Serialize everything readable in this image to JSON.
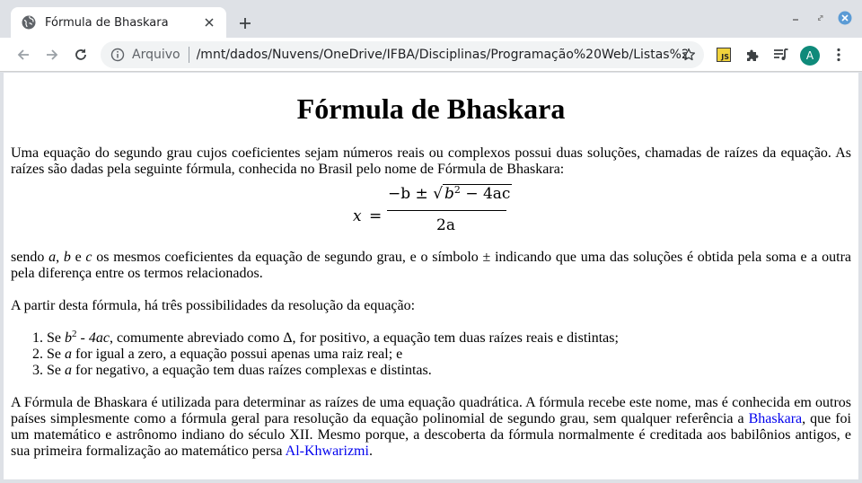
{
  "browser": {
    "tab_title": "Fórmula de Bhaskara",
    "omnibox_label": "Arquivo",
    "url": "/mnt/dados/Nuvens/OneDrive/IFBA/Disciplinas/Programação%20Web/Listas%20...",
    "avatar_initial": "A",
    "js_extension_label": "JS"
  },
  "page": {
    "title": "Fórmula de Bhaskara",
    "intro": "Uma equação do segundo grau cujos coeficientes sejam números reais ou complexos possui duas soluções, chamadas de raízes da equação. As raízes são dadas pela seguinte fórmula, conhecida no Brasil pelo nome de Fórmula de Bhaskara:",
    "formula": {
      "lhs": "x",
      "equals": "=",
      "numerator_prefix": "−b ± ",
      "radicand_b": "b",
      "radicand_exp": "2",
      "radicand_rest": " − 4ac",
      "denominator": "2a"
    },
    "p2": {
      "t1": "sendo ",
      "a": "a",
      "comma": ", ",
      "b": "b",
      "and": " e ",
      "c": "c",
      "t2": " os mesmos coeficientes da equação de segundo grau, e o símbolo ± indicando que uma das soluções é obtida pela soma e a outra pela diferença entre os termos relacionados."
    },
    "p3": "A partir desta fórmula, há três possibilidades da resolução da equação:",
    "list": {
      "item1": {
        "se": "Se ",
        "b": "b",
        "exp": "2",
        "rest_expr": " - 4ac",
        "text": ", comumente abreviado como Δ, for positivo, a equação tem duas raízes reais e distintas;"
      },
      "item2": {
        "se": "Se ",
        "a": "a",
        "text": " for igual a zero, a equação possui apenas uma raiz real; e"
      },
      "item3": {
        "se": "Se ",
        "a": "a",
        "text": " for negativo, a equação tem duas raízes complexas e distintas."
      }
    },
    "p4": {
      "t1": "A Fórmula de Bhaskara é utilizada para determinar as raízes de uma equação quadrática. A fórmula recebe este nome, mas é conhecida em outros países simplesmente como a fórmula geral para resolução da equação polinomial de segundo grau, sem qualquer referência a ",
      "link1": "Bhaskara",
      "t2": ", que foi um matemático e astrônomo indiano do século XII. Mesmo porque, a descoberta da fórmula normalmente é creditada aos babilônios antigos, e sua primeira formalização ao matemático persa ",
      "link2": "Al-Khwarizmi",
      "t3": "."
    }
  },
  "colors": {
    "link": "#0000ee",
    "avatar": "#0f8a7a",
    "close_button": "#5b9bd5"
  }
}
